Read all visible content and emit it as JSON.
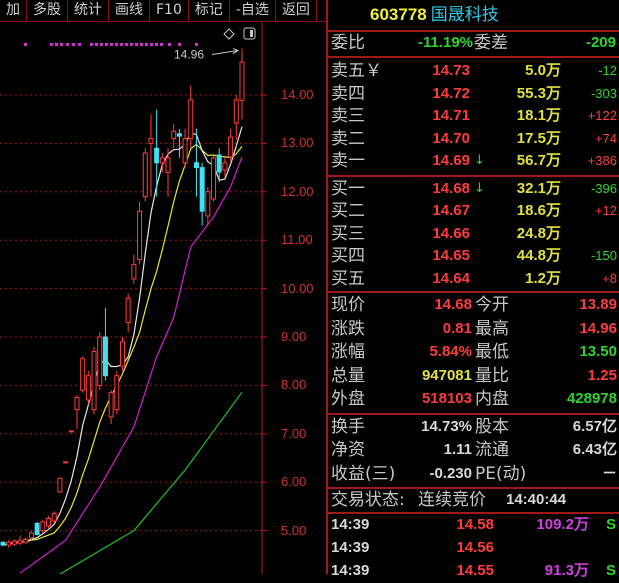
{
  "toolbar": {
    "items": [
      "加",
      "多股",
      "统计",
      "画线",
      "F10",
      "标记",
      "-自选",
      "返回"
    ]
  },
  "stock": {
    "code": "603778",
    "name": "国晟科技"
  },
  "weibi": {
    "label": "委比",
    "value": "-11.19%",
    "label2": "委差",
    "value2": "-209"
  },
  "sell": [
    {
      "label": "卖五￥",
      "price": "14.73",
      "vol": "5.0万",
      "chg": "-12",
      "chg_color": "grn",
      "arrow": ""
    },
    {
      "label": "卖四",
      "price": "14.72",
      "vol": "55.3万",
      "chg": "-303",
      "chg_color": "grn",
      "arrow": ""
    },
    {
      "label": "卖三",
      "price": "14.71",
      "vol": "18.1万",
      "chg": "+122",
      "chg_color": "red",
      "arrow": ""
    },
    {
      "label": "卖二",
      "price": "14.70",
      "vol": "17.5万",
      "chg": "+74",
      "chg_color": "red",
      "arrow": ""
    },
    {
      "label": "卖一",
      "price": "14.69",
      "vol": "56.7万",
      "chg": "+386",
      "chg_color": "red",
      "arrow": "↓"
    }
  ],
  "buy": [
    {
      "label": "买一",
      "price": "14.68",
      "vol": "32.1万",
      "chg": "-396",
      "chg_color": "grn",
      "arrow": "↓"
    },
    {
      "label": "买二",
      "price": "14.67",
      "vol": "18.6万",
      "chg": "+12",
      "chg_color": "red",
      "arrow": ""
    },
    {
      "label": "买三",
      "price": "14.66",
      "vol": "24.8万",
      "chg": "",
      "chg_color": "red",
      "arrow": ""
    },
    {
      "label": "买四",
      "price": "14.65",
      "vol": "44.8万",
      "chg": "-150",
      "chg_color": "grn",
      "arrow": ""
    },
    {
      "label": "买五",
      "price": "14.64",
      "vol": "1.2万",
      "chg": "+8",
      "chg_color": "red",
      "arrow": ""
    }
  ],
  "stats": [
    {
      "l1": "现价",
      "v1": "14.68",
      "c1": "red",
      "l2": "今开",
      "v2": "13.89",
      "c2": "red"
    },
    {
      "l1": "涨跌",
      "v1": "0.81",
      "c1": "red",
      "l2": "最高",
      "v2": "14.96",
      "c2": "red"
    },
    {
      "l1": "涨幅",
      "v1": "5.84%",
      "c1": "red",
      "l2": "最低",
      "v2": "13.50",
      "c2": "grn"
    },
    {
      "l1": "总量",
      "v1": "947081",
      "c1": "yel",
      "l2": "量比",
      "v2": "1.25",
      "c2": "red"
    },
    {
      "l1": "外盘",
      "v1": "518103",
      "c1": "red",
      "l2": "内盘",
      "v2": "428978",
      "c2": "grn"
    }
  ],
  "fund": [
    {
      "l1": "换手",
      "v1": "14.73%",
      "l2": "股本",
      "v2": "6.57亿"
    },
    {
      "l1": "净资",
      "v1": "1.11",
      "l2": "流通",
      "v2": "6.43亿"
    },
    {
      "l1": "收益(三)",
      "v1": "-0.230",
      "l2": "PE(动)",
      "v2": "－"
    }
  ],
  "status": {
    "label": "交易状态:",
    "value": "连续竞价",
    "time": "14:40:44"
  },
  "trades": [
    {
      "time": "14:39",
      "price": "14.58",
      "vol": "109.2万",
      "side": "S"
    },
    {
      "time": "14:39",
      "price": "14.56",
      "vol": "",
      "side": ""
    },
    {
      "time": "14:39",
      "price": "14.55",
      "vol": "91.3万",
      "side": "S"
    }
  ],
  "chart_data": {
    "type": "candlestick",
    "high_label": "14.96",
    "y_ticks": [
      "14.00",
      "13.00",
      "12.00",
      "11.00",
      "10.00",
      "9.00",
      "8.00",
      "7.00",
      "6.00",
      "5.00"
    ],
    "ylim": [
      3.9,
      15.3
    ],
    "colors": {
      "up": "#ff3c3c",
      "down": "#40e0f0",
      "ma5": "#e8e8e8",
      "ma10": "#e8e830",
      "ma20": "#d020d0",
      "ma60": "#20c020",
      "grid": "#a01818"
    },
    "candles": [
      [
        4.76,
        4.78,
        4.68,
        4.7
      ],
      [
        4.7,
        4.8,
        4.65,
        4.76
      ],
      [
        4.72,
        4.82,
        4.68,
        4.78
      ],
      [
        4.74,
        4.9,
        4.7,
        4.8
      ],
      [
        4.76,
        4.85,
        4.72,
        4.82
      ],
      [
        4.85,
        4.98,
        4.8,
        4.95
      ],
      [
        5.15,
        5.18,
        4.9,
        4.92
      ],
      [
        5.0,
        5.22,
        4.95,
        5.18
      ],
      [
        5.1,
        5.3,
        5.05,
        5.25
      ],
      [
        5.2,
        5.4,
        5.15,
        5.35
      ],
      [
        5.8,
        6.1,
        5.78,
        6.08
      ],
      [
        6.42,
        6.43,
        6.41,
        6.42
      ],
      [
        7.06,
        7.07,
        7.05,
        7.06
      ],
      [
        7.5,
        7.8,
        7.1,
        7.75
      ],
      [
        7.9,
        8.6,
        7.85,
        8.55
      ],
      [
        7.7,
        8.3,
        7.6,
        8.2
      ],
      [
        7.5,
        8.8,
        7.4,
        8.7
      ],
      [
        8.0,
        9.1,
        7.9,
        9.0
      ],
      [
        9.0,
        9.6,
        8.1,
        8.2
      ],
      [
        7.35,
        7.9,
        7.2,
        7.85
      ],
      [
        7.5,
        8.3,
        7.4,
        8.2
      ],
      [
        8.4,
        9.0,
        8.3,
        8.9
      ],
      [
        9.3,
        9.9,
        9.1,
        9.8
      ],
      [
        10.2,
        10.7,
        10.1,
        10.5
      ],
      [
        10.6,
        11.8,
        10.5,
        11.6
      ],
      [
        11.9,
        12.9,
        11.8,
        12.8
      ],
      [
        13.0,
        13.6,
        11.9,
        13.1
      ],
      [
        12.9,
        13.7,
        11.9,
        12.6
      ],
      [
        12.6,
        12.8,
        12.4,
        12.7
      ],
      [
        12.4,
        12.9,
        11.9,
        12.7
      ],
      [
        13.1,
        13.4,
        12.9,
        13.25
      ],
      [
        13.2,
        13.3,
        12.7,
        13.15
      ],
      [
        12.6,
        13.3,
        12.5,
        13.1
      ],
      [
        13.1,
        14.2,
        12.9,
        13.9
      ],
      [
        12.6,
        13.3,
        11.9,
        12.5
      ],
      [
        12.5,
        12.6,
        11.3,
        11.6
      ],
      [
        11.5,
        12.1,
        11.3,
        12.0
      ],
      [
        11.85,
        12.75,
        11.8,
        12.7
      ],
      [
        12.76,
        12.9,
        12.2,
        12.41
      ],
      [
        12.45,
        12.7,
        12.3,
        12.6
      ],
      [
        12.72,
        13.3,
        12.6,
        13.13
      ],
      [
        13.42,
        14.0,
        13.07,
        13.9
      ],
      [
        13.89,
        14.96,
        13.5,
        14.68
      ]
    ],
    "ma20": [
      [
        3,
        4.12
      ],
      [
        11,
        4.8
      ],
      [
        17,
        5.9
      ],
      [
        23,
        7.14
      ],
      [
        27,
        8.59
      ],
      [
        30,
        9.4
      ],
      [
        33,
        10.86
      ],
      [
        37,
        11.48
      ],
      [
        40,
        12.1
      ],
      [
        42,
        12.72
      ]
    ],
    "ma60": [
      [
        10,
        4.1
      ],
      [
        23,
        5.0
      ],
      [
        32,
        6.25
      ],
      [
        42,
        7.86
      ]
    ]
  }
}
